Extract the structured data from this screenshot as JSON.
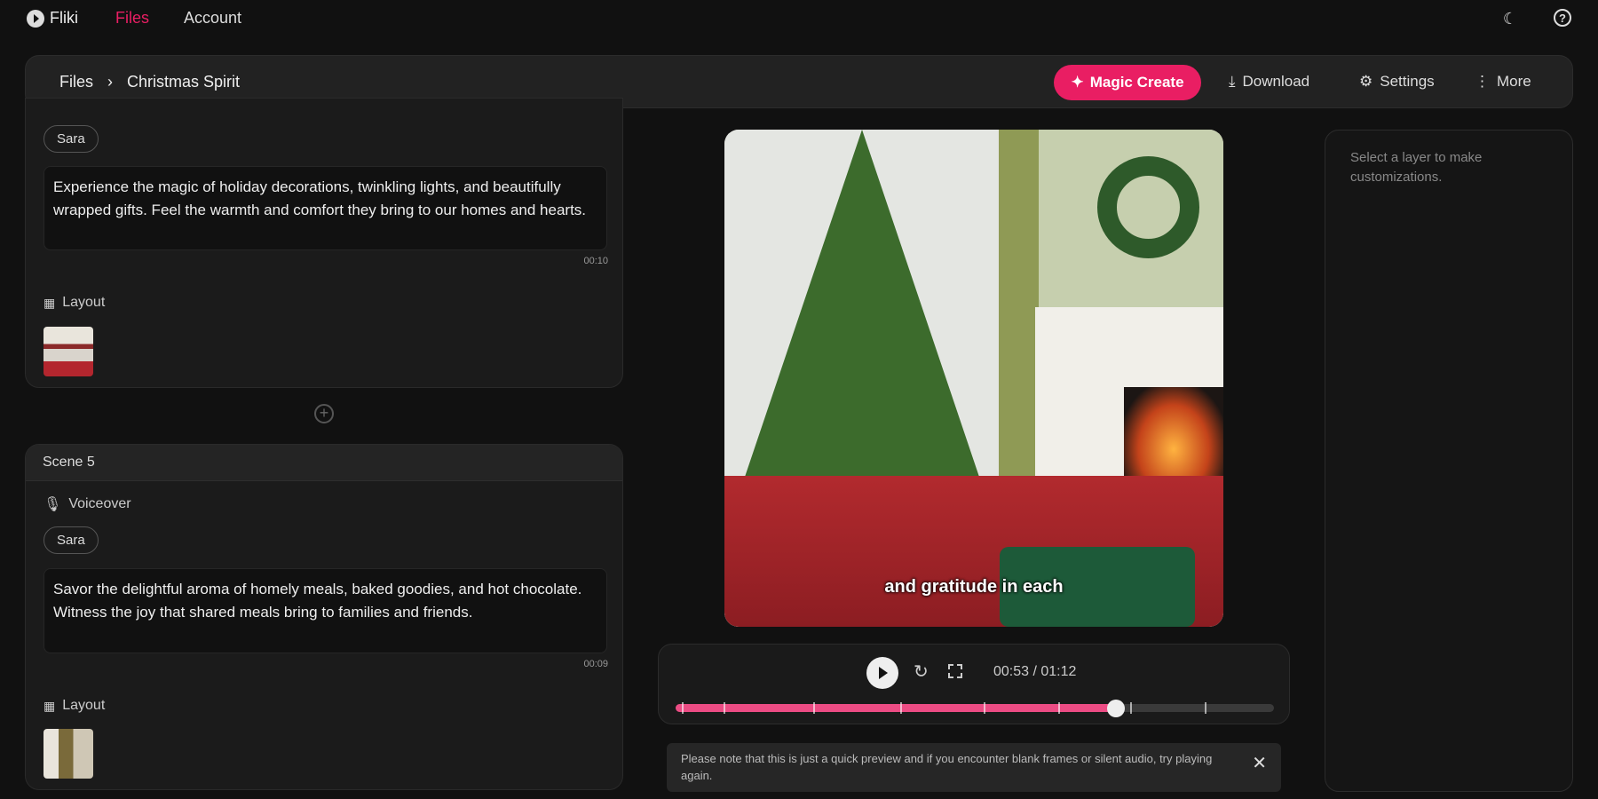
{
  "nav": {
    "brand": "Fliki",
    "links": [
      "Files",
      "Account"
    ],
    "active": "Files",
    "icons": [
      "moon-icon",
      "help-icon"
    ]
  },
  "header": {
    "breadcrumb": [
      "Files",
      "Christmas Spirit"
    ],
    "separator": "›",
    "magic_create": "Magic Create",
    "download": "Download",
    "settings": "Settings",
    "more": "More"
  },
  "scenes": [
    {
      "voice": "Sara",
      "text": "Experience the magic of holiday decorations, twinkling lights, and beautifully wrapped gifts. Feel the warmth and comfort they bring to our homes and hearts.",
      "duration": "00:10",
      "layout_label": "Layout"
    },
    {
      "title": "Scene 5",
      "voiceover_label": "Voiceover",
      "voice": "Sara",
      "text": "Savor the delightful aroma of homely meals, baked goodies, and hot chocolate. Witness the joy that shared meals bring to families and friends.",
      "duration": "00:09",
      "layout_label": "Layout"
    }
  ],
  "preview": {
    "caption": "and gratitude in each",
    "time": "00:53 / 01:12",
    "progress": 0.736,
    "scene_marks": [
      0.01,
      0.08,
      0.23,
      0.375,
      0.515,
      0.64,
      0.76,
      0.885
    ],
    "accent": "#e91e63"
  },
  "notice": {
    "text": "Please note that this is just a quick preview and if you encounter blank frames or silent audio, try playing again."
  },
  "right_panel": {
    "hint": "Select a layer to make customizations."
  }
}
